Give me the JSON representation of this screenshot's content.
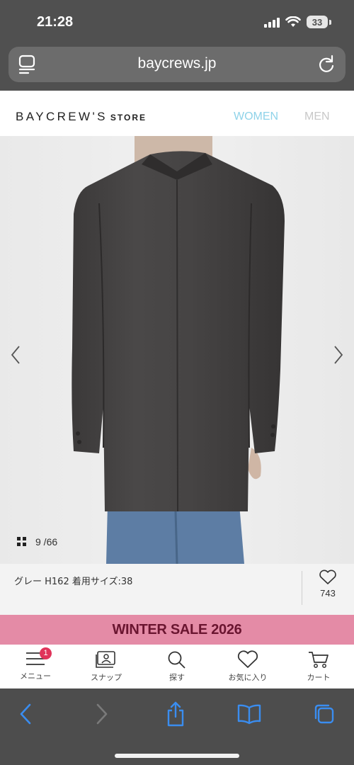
{
  "status_bar": {
    "time": "21:28",
    "battery": "33"
  },
  "browser": {
    "url": "baycrews.jp"
  },
  "site": {
    "logo_main": "BAYCREW'S",
    "logo_sub": "STORE",
    "nav": {
      "women": "WOMEN",
      "men": "MEN"
    }
  },
  "gallery": {
    "counter": "9 /66"
  },
  "caption": {
    "text": "グレー H162 着用サイズ:38",
    "favorite_count": "743"
  },
  "banner": {
    "text": "WINTER SALE 2026"
  },
  "tabbar": {
    "menu_badge": "1",
    "items": [
      {
        "label": "メニュー",
        "icon": "menu-icon"
      },
      {
        "label": "スナップ",
        "icon": "snap-icon"
      },
      {
        "label": "探す",
        "icon": "search-icon"
      },
      {
        "label": "お気に入り",
        "icon": "heart-icon"
      },
      {
        "label": "カート",
        "icon": "cart-icon"
      }
    ]
  },
  "colors": {
    "accent_women": "#8fd3e9",
    "banner_bg": "#e48ba6",
    "banner_text": "#6a1530",
    "safari_blue": "#3a8df0",
    "badge": "#e0345a"
  }
}
